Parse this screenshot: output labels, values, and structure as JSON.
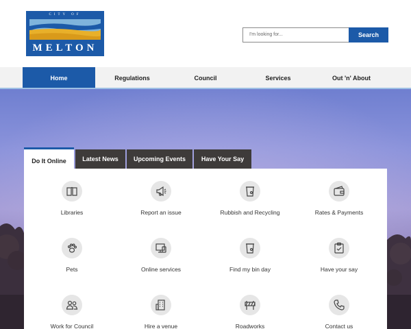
{
  "logo": {
    "top_text": "CITY OF",
    "bottom_text": "MELTON"
  },
  "search": {
    "placeholder": "I'm looking for...",
    "button_label": "Search"
  },
  "nav": {
    "items": [
      {
        "label": "Home",
        "active": true
      },
      {
        "label": "Regulations"
      },
      {
        "label": "Council"
      },
      {
        "label": "Services"
      },
      {
        "label": "Out 'n' About"
      }
    ]
  },
  "tabs": [
    {
      "label": "Do It Online",
      "active": true
    },
    {
      "label": "Latest News"
    },
    {
      "label": "Upcoming Events"
    },
    {
      "label": "Have Your Say"
    }
  ],
  "tiles": [
    {
      "label": "Libraries",
      "icon": "book-icon"
    },
    {
      "label": "Report an issue",
      "icon": "megaphone-icon"
    },
    {
      "label": "Rubbish and Recycling",
      "icon": "bin-icon"
    },
    {
      "label": "Rates & Payments",
      "icon": "wallet-icon"
    },
    {
      "label": "Pets",
      "icon": "paw-icon"
    },
    {
      "label": "Online services",
      "icon": "devices-icon"
    },
    {
      "label": "Find my bin day",
      "icon": "bin-icon"
    },
    {
      "label": "Have your say",
      "icon": "clipboard-icon"
    },
    {
      "label": "Work for Council",
      "icon": "people-icon"
    },
    {
      "label": "Hire a venue",
      "icon": "building-icon"
    },
    {
      "label": "Roadworks",
      "icon": "barrier-icon"
    },
    {
      "label": "Contact us",
      "icon": "phone-icon"
    }
  ],
  "colors": {
    "brand_blue": "#1c5aa8",
    "tab_dark": "#3e3b3a",
    "nav_bg": "#f2f2f2"
  }
}
